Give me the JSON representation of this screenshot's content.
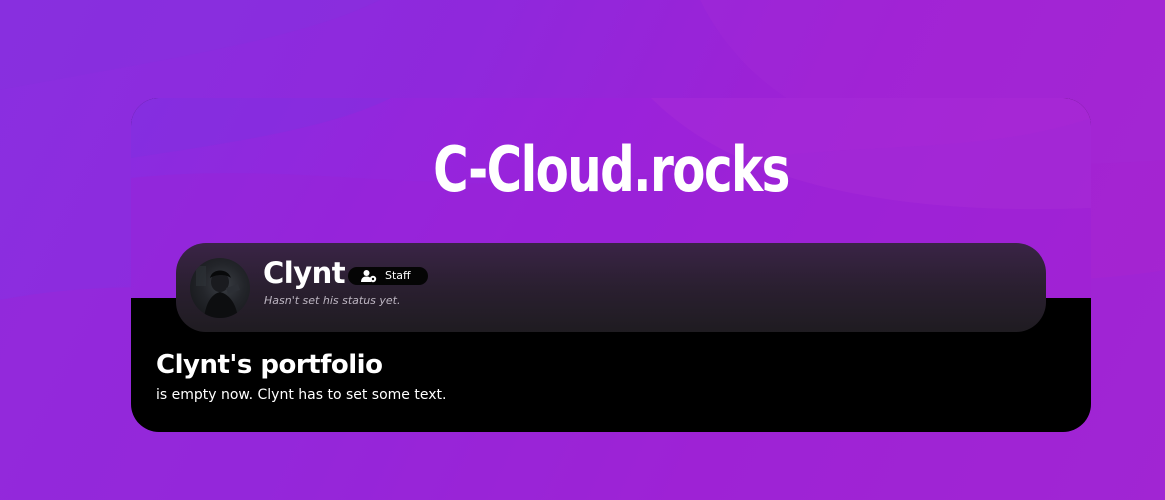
{
  "colors": {
    "background_start": "#8a2fe0",
    "background_end": "#a626d0",
    "card_bottom": "#000000",
    "profile_bar": "#2a1f30",
    "text": "#ffffff",
    "status_text": "#bdb6c2"
  },
  "header": {
    "site_title": "C-Cloud.rocks"
  },
  "profile": {
    "avatar_icon": "avatar",
    "username": "Clynt",
    "badge": {
      "icon": "user-gear-icon",
      "label": "Staff"
    },
    "status": "Hasn't set his status yet."
  },
  "portfolio": {
    "title": "Clynt's portfolio",
    "text": "is empty now. Clynt has to set some text."
  }
}
